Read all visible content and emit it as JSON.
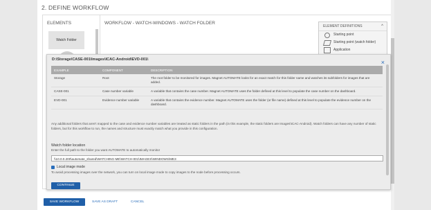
{
  "section_title": "2. DEFINE WORKFLOW",
  "elements_panel": {
    "title": "ELEMENTS",
    "tile_label": "Watch Folder"
  },
  "canvas_title": "WORKFLOW - WATCH-WINDOWS - WATCH FOLDER",
  "element_definitions": {
    "title": "ELEMENT DEFINITIONS",
    "caret": "^",
    "items": [
      {
        "label": "Starting point",
        "icon": "circle-icon"
      },
      {
        "label": "Starting point (watch folder)",
        "icon": "parallelogram-icon"
      },
      {
        "label": "Application",
        "icon": "rectangle-icon"
      }
    ]
  },
  "modal": {
    "path": "D:\\Storage\\CASE-001\\Images\\ICAC-Android\\EVD-001\\",
    "close_label": "×",
    "table": {
      "headers": [
        "EXAMPLE",
        "COMPONENT",
        "DESCRIPTION"
      ],
      "rows": [
        [
          "Storage",
          "Root",
          "The root folder to be monitored for images. Magnet AUTOMATE looks for an exact match for this folder name and watches its subfolders for images that are added."
        ],
        [
          "CASE-001",
          "Case number variable",
          "A variable that contains the case number. Magnet AUTOMATE uses the folder defined at this level to populate the case number on the dashboard."
        ],
        [
          "EVD-001",
          "Evidence number variable",
          "A variable that contains the evidence number. Magnet AUTOMATE uses the folder (or file name) defined at this level to populate the evidence number on the dashboard."
        ]
      ]
    },
    "note": "Any additional folders that aren't mapped to the case and evidence number variables are treated as static folders in the path (in this example, the static folders are Images\\ICAC-Android). Watch folders can have any number of static folders, but for this workflow to run, the names and structure must exactly match what you provide in this configuration.",
    "folder_location_label": "Watch folder location",
    "folder_location_hint": "Enter the full path to the folder you want AUTOMATE to automatically monitor",
    "folder_location_value": "\\\\10.0.0.200\\automate_shared\\WATCHING-ME\\WATCH-001\\IMAGES\\WINDOWS\\ME3",
    "local_mode_label": "Local image mode",
    "local_mode_checked": true,
    "local_mode_hint": "To avoid processing images over the network, you can turn on local image mode to copy images to the node before processing occurs.",
    "continue_label": "CONTINUE"
  },
  "footer": {
    "save_label": "SAVE WORKFLOW",
    "draft_label": "SAVE AS DRAFT",
    "cancel_label": "CANCEL"
  },
  "colors": {
    "accent": "#1f5fa8",
    "link": "#2a6ebb",
    "table_header": "#aaaaaa"
  }
}
